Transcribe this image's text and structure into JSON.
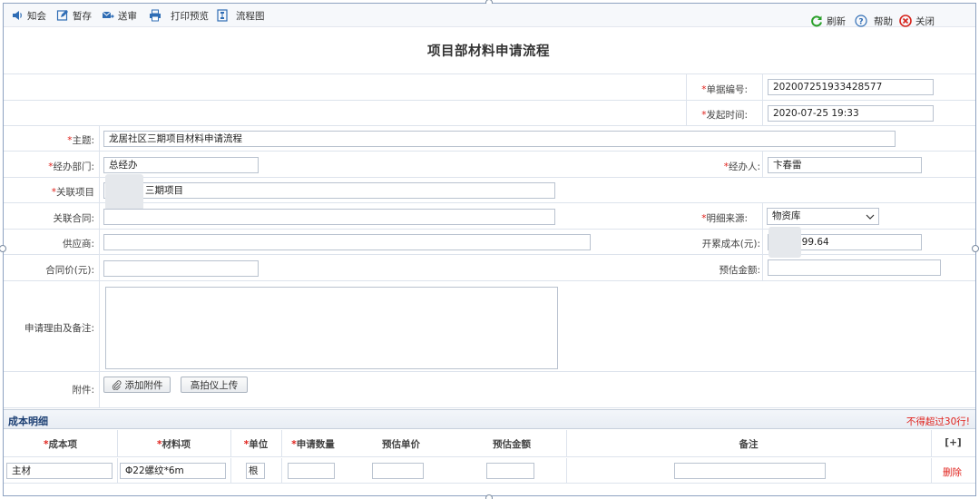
{
  "toolbar": {
    "left": [
      {
        "label": "知会",
        "icon": "speaker-icon"
      },
      {
        "label": "暂存",
        "icon": "edit-icon"
      },
      {
        "label": "送审",
        "icon": "send-icon"
      },
      {
        "label": "打印预览",
        "icon": "printer-icon"
      },
      {
        "label": "流程图",
        "icon": "flowchart-icon"
      }
    ],
    "right": [
      {
        "label": "刷新",
        "icon": "refresh-icon"
      },
      {
        "label": "帮助",
        "icon": "help-icon"
      },
      {
        "label": "关闭",
        "icon": "close-icon"
      }
    ]
  },
  "page_title": "项目部材料申请流程",
  "form": {
    "doc_no": {
      "label": "单据编号:",
      "value": "202007251933428577"
    },
    "start_time": {
      "label": "发起时间:",
      "value": "2020-07-25 19:33"
    },
    "subject": {
      "label": "主题:",
      "value": "龙居社区三期项目材料申请流程"
    },
    "dept": {
      "label": "经办部门:",
      "value": "总经办"
    },
    "handler": {
      "label": "经办人:",
      "value": "卞春雷"
    },
    "project": {
      "label": "关联项目",
      "value": "三期项目"
    },
    "contract": {
      "label": "关联合同:",
      "value": ""
    },
    "detail_source": {
      "label": "明细来源:",
      "value": "物资库"
    },
    "supplier": {
      "label": "供应商:",
      "value": ""
    },
    "billed_cost": {
      "label": "开累成本(元):",
      "value": "199.64"
    },
    "contract_price": {
      "label": "合同价(元):",
      "value": ""
    },
    "est_amount_total": {
      "label": "预估金额:",
      "value": ""
    },
    "reason": {
      "label": "申请理由及备注:",
      "value": ""
    },
    "attachment": {
      "label": "附件:",
      "add_label": "添加附件",
      "scan_label": "高拍仪上传"
    }
  },
  "cost_detail": {
    "title": "成本明细",
    "note": "不得超过30行!",
    "columns": [
      "成本项",
      "材料项",
      "单位",
      "申请数量",
      "预估单价",
      "预估金额",
      "备注",
      "[+]"
    ],
    "rows": [
      {
        "cost_item": "主材",
        "material": "Φ22螺纹*6m",
        "unit": "根",
        "qty": "",
        "unit_price": "",
        "amount": "",
        "remark": "",
        "action": "删除"
      }
    ]
  },
  "required_mark": "*",
  "colors": {
    "accent": "#1c3f73",
    "required": "#e0221c",
    "border": "#dde3ec"
  }
}
